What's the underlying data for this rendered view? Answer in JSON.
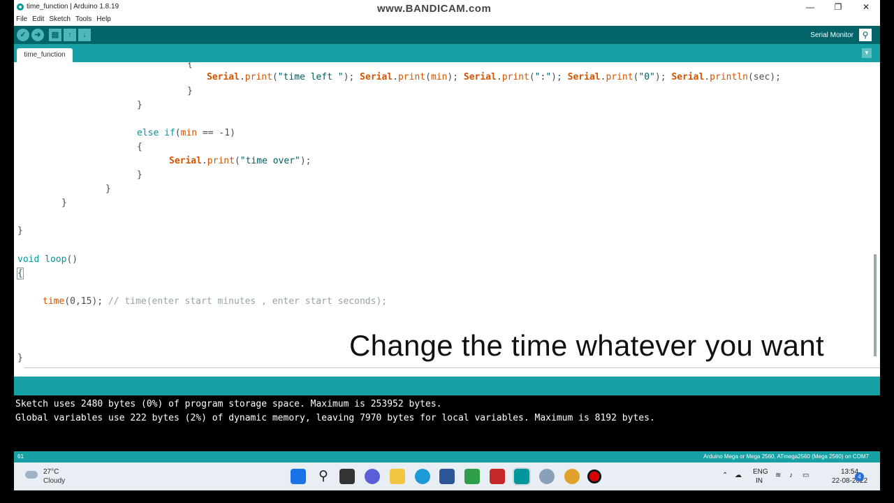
{
  "window": {
    "title": "time_function | Arduino 1.8.19",
    "watermark": "www.BANDICAM.com",
    "controls": {
      "minimize": "—",
      "maximize": "❐",
      "close": "✕"
    }
  },
  "menu": [
    "File",
    "Edit",
    "Sketch",
    "Tools",
    "Help"
  ],
  "toolbar": {
    "verify_icon": "check-icon",
    "upload_icon": "arrow-right-icon",
    "new_icon": "file-icon",
    "open_icon": "arrow-up-icon",
    "save_icon": "arrow-down-icon",
    "serial_monitor_label": "Serial Monitor"
  },
  "tabs": [
    {
      "label": "time_function"
    }
  ],
  "editor": {
    "overlay_caption": "Change the time whatever you want"
  },
  "console": {
    "lines": [
      "Sketch uses 2480 bytes (0%) of program storage space. Maximum is 253952 bytes.",
      "Global variables use 222 bytes (2%) of dynamic memory, leaving 7970 bytes for local variables. Maximum is 8192 bytes."
    ]
  },
  "status": {
    "line_number": "61",
    "board": "Arduino Mega or Mega 2560, ATmega2560 (Mega 2560) on COM7"
  },
  "taskbar": {
    "weather_temp": "27°C",
    "weather_desc": "Cloudy",
    "lang_top": "ENG",
    "lang_bottom": "IN",
    "time": "13:54",
    "date": "22-08-2022",
    "notification_count": "4"
  },
  "colors": {
    "toolbar": "#006468",
    "tabbar": "#17a1a5",
    "keyword_function": "#d35400",
    "keyword_type": "#00979c"
  }
}
